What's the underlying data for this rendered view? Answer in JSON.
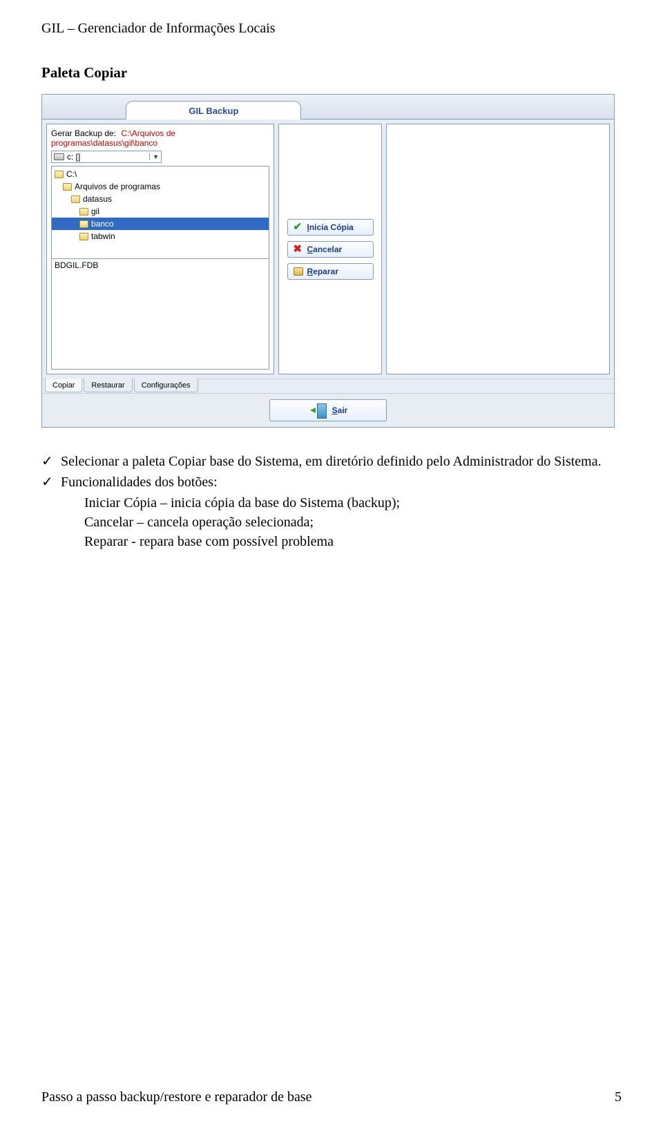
{
  "doc": {
    "header": "GIL – Gerenciador de Informações Locais",
    "section_title": "Paleta Copiar",
    "footer_text": "Passo a passo backup/restore e reparador de base",
    "page_number": "5"
  },
  "window": {
    "title": "GIL Backup",
    "gerar_label": "Gerar Backup de:",
    "path": "C:\\Arquivos de programas\\datasus\\gil\\banco",
    "drive_label": "c: []",
    "tree": [
      {
        "label": "C:\\",
        "indent": 0
      },
      {
        "label": "Arquivos de programas",
        "indent": 1
      },
      {
        "label": "datasus",
        "indent": 2
      },
      {
        "label": "gil",
        "indent": 3
      },
      {
        "label": "banco",
        "indent": 3,
        "selected": true
      },
      {
        "label": "tabwin",
        "indent": 3
      }
    ],
    "file_list": [
      "BDGIL.FDB"
    ],
    "buttons": {
      "inicia": {
        "first": "I",
        "rest": "nicia Cópia"
      },
      "cancelar": {
        "first": "C",
        "rest": "ancelar"
      },
      "reparar": {
        "first": "R",
        "rest": "eparar"
      }
    },
    "tabs": [
      "Copiar",
      "Restaurar",
      "Configurações"
    ],
    "sair": {
      "first": "S",
      "rest": "air"
    }
  },
  "bullets": {
    "b1": "Selecionar a paleta Copiar base do Sistema, em diretório definido pelo Administrador do Sistema.",
    "b2": "Funcionalidades dos botões:",
    "s1": "Iniciar Cópia – inicia cópia da base do Sistema (backup);",
    "s2": "Cancelar – cancela operação selecionada;",
    "s3": "Reparar -    repara base com possível problema"
  }
}
